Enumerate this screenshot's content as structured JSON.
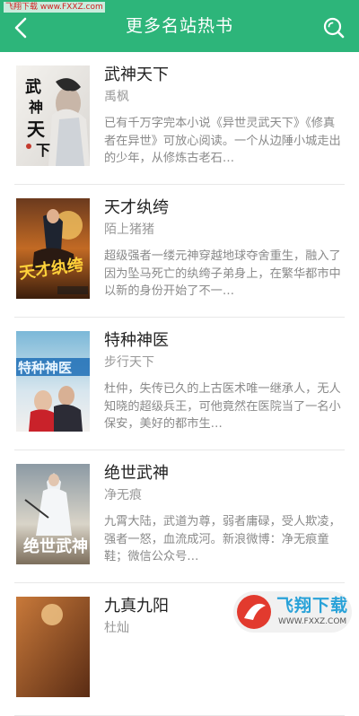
{
  "status": {
    "text": "飞翔下载 www.FXXZ.com"
  },
  "header": {
    "title": "更多名站热书",
    "back_icon": "back-arrow-icon",
    "search_icon": "search-icon"
  },
  "books": [
    {
      "title": "武神天下",
      "author": "禹枫",
      "desc": "已有千万字完本小说《异世灵武天下》《修真者在异世》可放心阅读。一个从边陲小城走出的少年，从修炼古老石…"
    },
    {
      "title": "天才纨绔",
      "author": "陌上猪猪",
      "desc": "超级强者一缕元神穿越地球夺舍重生，融入了因为坠马死亡的纨绔子弟身上，在繁华都市中以新的身份开始了不一…"
    },
    {
      "title": "特种神医",
      "author": "步行天下",
      "desc": "杜仲，失传已久的上古医术唯一继承人，无人知晓的超级兵王，可他竟然在医院当了一名小保安，美好的都市生…"
    },
    {
      "title": "绝世武神",
      "author": "净无痕",
      "desc": "九霄大陆，武道为尊，弱者庸碌，受人欺凌，强者一怒，血流成河。新浪微博：净无痕童鞋；微信公众号…"
    },
    {
      "title": "九真九阳",
      "author": "杜灿",
      "desc": ""
    }
  ],
  "watermark": {
    "text": "飞翔下载",
    "url": "WWW.FXXZ.COM"
  }
}
